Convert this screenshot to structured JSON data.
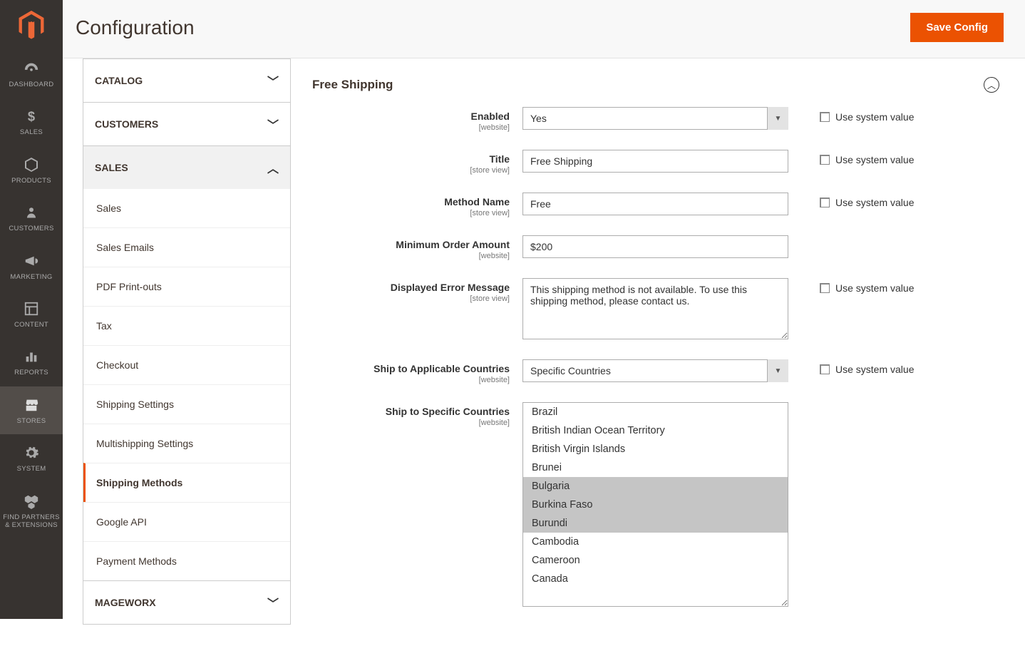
{
  "header": {
    "page_title": "Configuration",
    "save_button": "Save Config"
  },
  "admin_nav": {
    "items": [
      {
        "id": "dashboard",
        "label": "DASHBOARD",
        "icon": "gauge"
      },
      {
        "id": "sales",
        "label": "SALES",
        "icon": "dollar"
      },
      {
        "id": "products",
        "label": "PRODUCTS",
        "icon": "cube"
      },
      {
        "id": "customers",
        "label": "CUSTOMERS",
        "icon": "person"
      },
      {
        "id": "marketing",
        "label": "MARKETING",
        "icon": "megaphone"
      },
      {
        "id": "content",
        "label": "CONTENT",
        "icon": "layout"
      },
      {
        "id": "reports",
        "label": "REPORTS",
        "icon": "bars"
      },
      {
        "id": "stores",
        "label": "STORES",
        "icon": "storefront",
        "active": true
      },
      {
        "id": "system",
        "label": "SYSTEM",
        "icon": "gear"
      },
      {
        "id": "partners",
        "label": "FIND PARTNERS & EXTENSIONS",
        "icon": "boxes"
      }
    ]
  },
  "config_nav": {
    "sections": [
      {
        "id": "catalog",
        "label": "CATALOG",
        "expanded": false
      },
      {
        "id": "customers",
        "label": "CUSTOMERS",
        "expanded": false
      },
      {
        "id": "sales",
        "label": "SALES",
        "expanded": true,
        "items": [
          {
            "id": "sales",
            "label": "Sales"
          },
          {
            "id": "sales-emails",
            "label": "Sales Emails"
          },
          {
            "id": "pdf",
            "label": "PDF Print-outs"
          },
          {
            "id": "tax",
            "label": "Tax"
          },
          {
            "id": "checkout",
            "label": "Checkout"
          },
          {
            "id": "shipping-settings",
            "label": "Shipping Settings"
          },
          {
            "id": "multishipping",
            "label": "Multishipping Settings"
          },
          {
            "id": "shipping-methods",
            "label": "Shipping Methods",
            "active": true
          },
          {
            "id": "google-api",
            "label": "Google API"
          },
          {
            "id": "payment-methods",
            "label": "Payment Methods"
          }
        ]
      },
      {
        "id": "mageworx",
        "label": "MAGEWORX",
        "expanded": false
      }
    ]
  },
  "section": {
    "title": "Free Shipping"
  },
  "fields": {
    "enabled": {
      "label": "Enabled",
      "scope": "[website]",
      "value": "Yes",
      "use_system": "Use system value"
    },
    "title": {
      "label": "Title",
      "scope": "[store view]",
      "value": "Free Shipping",
      "use_system": "Use system value"
    },
    "method_name": {
      "label": "Method Name",
      "scope": "[store view]",
      "value": "Free",
      "use_system": "Use system value"
    },
    "min_amount": {
      "label": "Minimum Order Amount",
      "scope": "[website]",
      "value": "$200"
    },
    "error_msg": {
      "label": "Displayed Error Message",
      "scope": "[store view]",
      "value": "This shipping method is not available. To use this shipping method, please contact us.",
      "use_system": "Use system value"
    },
    "ship_applicable": {
      "label": "Ship to Applicable Countries",
      "scope": "[website]",
      "value": "Specific Countries",
      "use_system": "Use system value"
    },
    "ship_specific": {
      "label": "Ship to Specific Countries",
      "scope": "[website]",
      "options": [
        {
          "label": "Brazil",
          "selected": false
        },
        {
          "label": "British Indian Ocean Territory",
          "selected": false
        },
        {
          "label": "British Virgin Islands",
          "selected": false
        },
        {
          "label": "Brunei",
          "selected": false
        },
        {
          "label": "Bulgaria",
          "selected": true
        },
        {
          "label": "Burkina Faso",
          "selected": true
        },
        {
          "label": "Burundi",
          "selected": true
        },
        {
          "label": "Cambodia",
          "selected": false
        },
        {
          "label": "Cameroon",
          "selected": false
        },
        {
          "label": "Canada",
          "selected": false
        }
      ]
    }
  }
}
